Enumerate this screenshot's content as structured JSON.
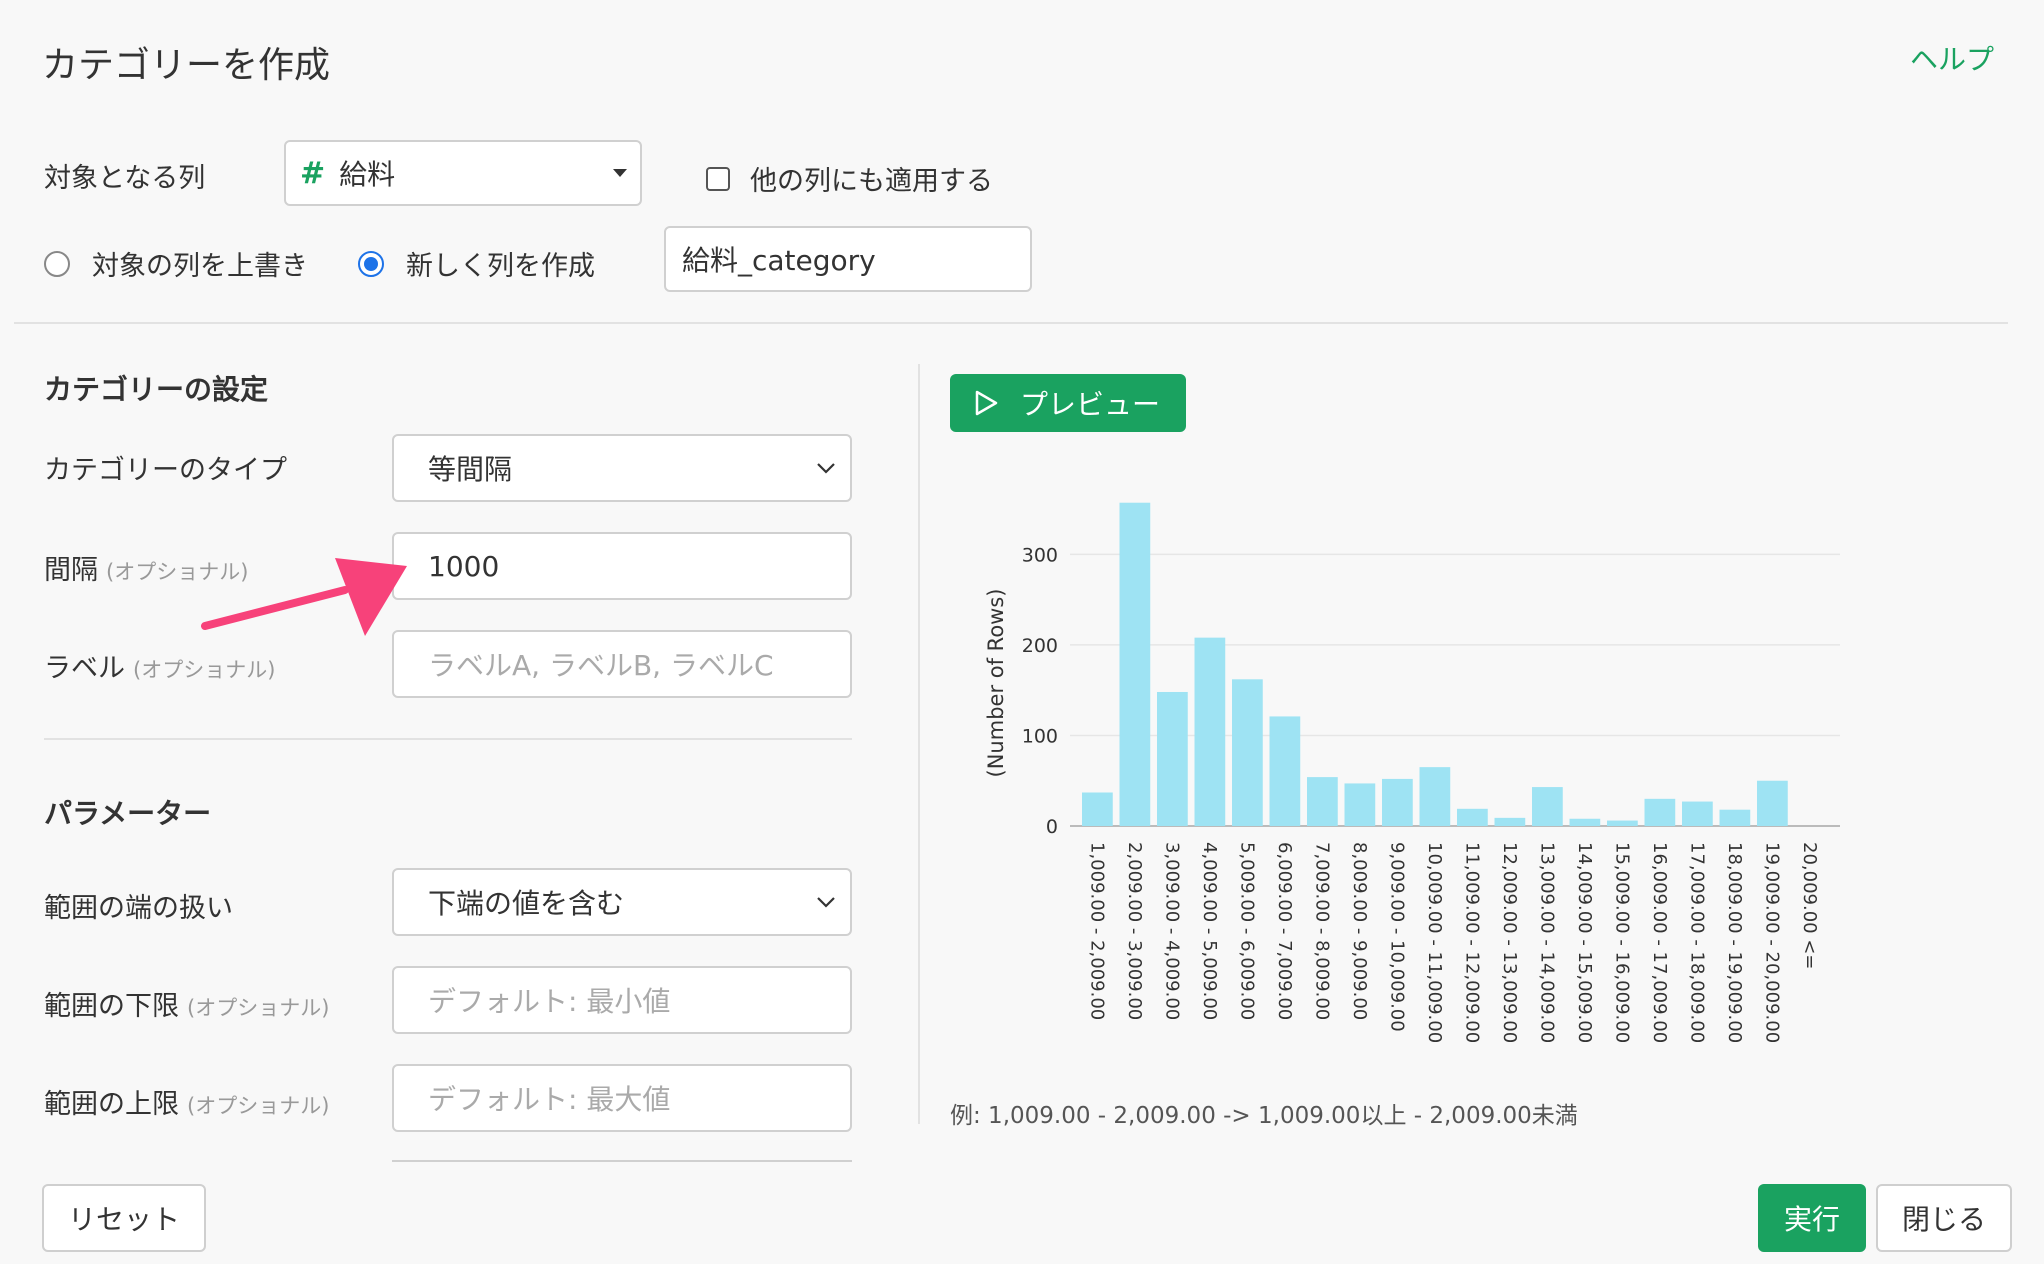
{
  "header": {
    "title": "カテゴリーを作成",
    "help_label": "ヘルプ"
  },
  "target": {
    "label": "対象となる列",
    "column_icon": "#",
    "column_value": "給料",
    "apply_other_label": "他の列にも適用する",
    "apply_other_checked": false,
    "overwrite_label": "対象の列を上書き",
    "new_column_label": "新しく列を作成",
    "new_column_selected": true,
    "new_column_name": "給料_category"
  },
  "category_settings": {
    "heading": "カテゴリーの設定",
    "type_label": "カテゴリーのタイプ",
    "type_value": "等間隔",
    "interval_label": "間隔",
    "interval_optional": "(オプショナル)",
    "interval_value": "1000",
    "label_label": "ラベル",
    "label_optional": "(オプショナル)",
    "label_placeholder": "ラベルA, ラベルB, ラベルC"
  },
  "parameters": {
    "heading": "パラメーター",
    "edge_label": "範囲の端の扱い",
    "edge_value": "下端の値を含む",
    "lower_label": "範囲の下限",
    "lower_optional": "(オプショナル)",
    "lower_placeholder": "デフォルト: 最小値",
    "upper_label": "範囲の上限",
    "upper_optional": "(オプショナル)",
    "upper_placeholder": "デフォルト: 最大値"
  },
  "preview": {
    "button_label": "プレビュー"
  },
  "chart_note": "例: 1,009.00 - 2,009.00 -> 1,009.00以上 - 2,009.00未満",
  "footer": {
    "reset_label": "リセット",
    "run_label": "実行",
    "close_label": "閉じる"
  },
  "colors": {
    "accent": "#1aa260",
    "bar": "#9ee3f3",
    "annotation_arrow": "#f7427a",
    "radio": "#1e73e8"
  },
  "chart_data": {
    "type": "bar",
    "ylabel": "(Number of Rows)",
    "xlabel": "",
    "ylim": [
      0,
      360
    ],
    "yticks": [
      0,
      100,
      200,
      300
    ],
    "grid": true,
    "categories": [
      "1,009.00 - 2,009.00",
      "2,009.00 - 3,009.00",
      "3,009.00 - 4,009.00",
      "4,009.00 - 5,009.00",
      "5,009.00 - 6,009.00",
      "6,009.00 - 7,009.00",
      "7,009.00 - 8,009.00",
      "8,009.00 - 9,009.00",
      "9,009.00 - 10,009.00",
      "10,009.00 - 11,009.00",
      "11,009.00 - 12,009.00",
      "12,009.00 - 13,009.00",
      "13,009.00 - 14,009.00",
      "14,009.00 - 15,009.00",
      "15,009.00 - 16,009.00",
      "16,009.00 - 17,009.00",
      "17,009.00 - 18,009.00",
      "18,009.00 - 19,009.00",
      "19,009.00 - 20,009.00",
      "20,009.00 <="
    ],
    "values": [
      37,
      357,
      148,
      208,
      162,
      121,
      54,
      47,
      52,
      65,
      19,
      9,
      43,
      8,
      6,
      30,
      27,
      18,
      50,
      0
    ]
  }
}
